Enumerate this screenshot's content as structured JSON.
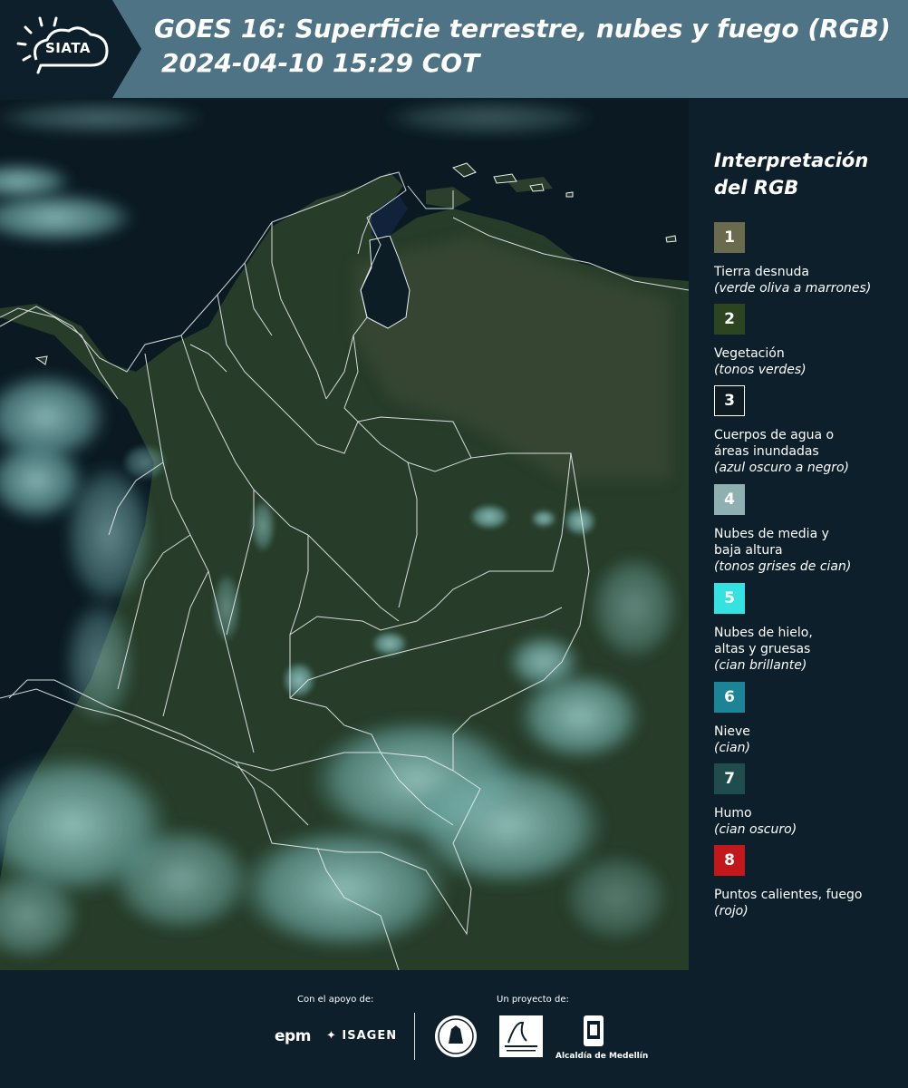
{
  "header": {
    "logo_text": "SIATA",
    "title": "GOES 16: Superficie terrestre, nubes y fuego (RGB)",
    "timestamp": "2024-04-10 15:29 COT"
  },
  "legend": {
    "title": "Interpretación del RGB",
    "items": [
      {
        "number": "1",
        "label": "Tierra desnuda",
        "sub": "(verde oliva a marrones)",
        "color": "#6a6a4c"
      },
      {
        "number": "2",
        "label": "Vegetación",
        "sub": "(tonos verdes)",
        "color": "#2d4420"
      },
      {
        "number": "3",
        "label": "Cuerpos de agua o áreas inundadas",
        "sub": "(azul oscuro a negro)",
        "color": "#0f1b22"
      },
      {
        "number": "4",
        "label": "Nubes de media y baja altura",
        "sub": "(tonos grises de cian)",
        "color": "#8fb0b1"
      },
      {
        "number": "5",
        "label": "Nubes de hielo, altas y gruesas",
        "sub": "(cian brillante)",
        "color": "#34e3e1"
      },
      {
        "number": "6",
        "label": "Nieve",
        "sub": "(cian)",
        "color": "#1d8497"
      },
      {
        "number": "7",
        "label": "Humo",
        "sub": "(cian oscuro)",
        "color": "#1f4c4d"
      },
      {
        "number": "8",
        "label": "Puntos calientes, fuego",
        "sub": "(rojo)",
        "color": "#c0181b"
      }
    ]
  },
  "footer": {
    "support_label": "Con el apoyo de:",
    "project_label": "Un proyecto de:",
    "sponsors": [
      "epm",
      "ISAGEN"
    ],
    "alcaldia_label": "Alcaldía de Medellín"
  },
  "colors": {
    "header_bg": "#4e7384",
    "logo_bg": "#0c1f2b",
    "page_bg": "#0c1f2b",
    "ocean": "#0b1a22",
    "land": "#283d2a",
    "cloud": "#8ed0cf"
  }
}
